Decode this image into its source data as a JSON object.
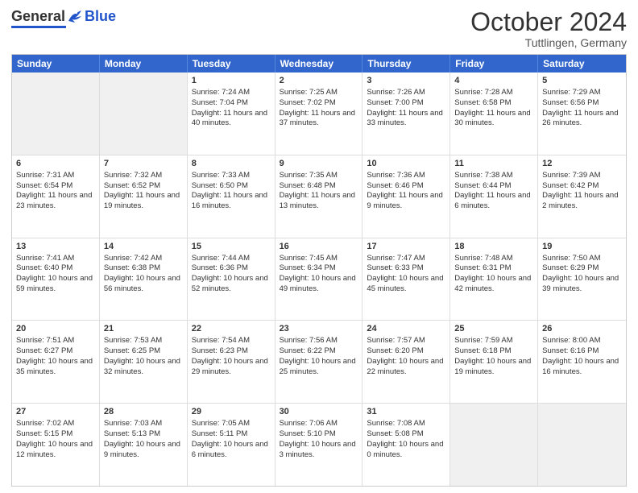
{
  "logo": {
    "general": "General",
    "blue": "Blue"
  },
  "header": {
    "month": "October 2024",
    "location": "Tuttlingen, Germany"
  },
  "days": [
    "Sunday",
    "Monday",
    "Tuesday",
    "Wednesday",
    "Thursday",
    "Friday",
    "Saturday"
  ],
  "rows": [
    [
      {
        "day": "",
        "sunrise": "",
        "sunset": "",
        "daylight": "",
        "shaded": true
      },
      {
        "day": "",
        "sunrise": "",
        "sunset": "",
        "daylight": "",
        "shaded": true
      },
      {
        "day": "1",
        "sunrise": "Sunrise: 7:24 AM",
        "sunset": "Sunset: 7:04 PM",
        "daylight": "Daylight: 11 hours and 40 minutes."
      },
      {
        "day": "2",
        "sunrise": "Sunrise: 7:25 AM",
        "sunset": "Sunset: 7:02 PM",
        "daylight": "Daylight: 11 hours and 37 minutes."
      },
      {
        "day": "3",
        "sunrise": "Sunrise: 7:26 AM",
        "sunset": "Sunset: 7:00 PM",
        "daylight": "Daylight: 11 hours and 33 minutes."
      },
      {
        "day": "4",
        "sunrise": "Sunrise: 7:28 AM",
        "sunset": "Sunset: 6:58 PM",
        "daylight": "Daylight: 11 hours and 30 minutes."
      },
      {
        "day": "5",
        "sunrise": "Sunrise: 7:29 AM",
        "sunset": "Sunset: 6:56 PM",
        "daylight": "Daylight: 11 hours and 26 minutes."
      }
    ],
    [
      {
        "day": "6",
        "sunrise": "Sunrise: 7:31 AM",
        "sunset": "Sunset: 6:54 PM",
        "daylight": "Daylight: 11 hours and 23 minutes."
      },
      {
        "day": "7",
        "sunrise": "Sunrise: 7:32 AM",
        "sunset": "Sunset: 6:52 PM",
        "daylight": "Daylight: 11 hours and 19 minutes."
      },
      {
        "day": "8",
        "sunrise": "Sunrise: 7:33 AM",
        "sunset": "Sunset: 6:50 PM",
        "daylight": "Daylight: 11 hours and 16 minutes."
      },
      {
        "day": "9",
        "sunrise": "Sunrise: 7:35 AM",
        "sunset": "Sunset: 6:48 PM",
        "daylight": "Daylight: 11 hours and 13 minutes."
      },
      {
        "day": "10",
        "sunrise": "Sunrise: 7:36 AM",
        "sunset": "Sunset: 6:46 PM",
        "daylight": "Daylight: 11 hours and 9 minutes."
      },
      {
        "day": "11",
        "sunrise": "Sunrise: 7:38 AM",
        "sunset": "Sunset: 6:44 PM",
        "daylight": "Daylight: 11 hours and 6 minutes."
      },
      {
        "day": "12",
        "sunrise": "Sunrise: 7:39 AM",
        "sunset": "Sunset: 6:42 PM",
        "daylight": "Daylight: 11 hours and 2 minutes."
      }
    ],
    [
      {
        "day": "13",
        "sunrise": "Sunrise: 7:41 AM",
        "sunset": "Sunset: 6:40 PM",
        "daylight": "Daylight: 10 hours and 59 minutes."
      },
      {
        "day": "14",
        "sunrise": "Sunrise: 7:42 AM",
        "sunset": "Sunset: 6:38 PM",
        "daylight": "Daylight: 10 hours and 56 minutes."
      },
      {
        "day": "15",
        "sunrise": "Sunrise: 7:44 AM",
        "sunset": "Sunset: 6:36 PM",
        "daylight": "Daylight: 10 hours and 52 minutes."
      },
      {
        "day": "16",
        "sunrise": "Sunrise: 7:45 AM",
        "sunset": "Sunset: 6:34 PM",
        "daylight": "Daylight: 10 hours and 49 minutes."
      },
      {
        "day": "17",
        "sunrise": "Sunrise: 7:47 AM",
        "sunset": "Sunset: 6:33 PM",
        "daylight": "Daylight: 10 hours and 45 minutes."
      },
      {
        "day": "18",
        "sunrise": "Sunrise: 7:48 AM",
        "sunset": "Sunset: 6:31 PM",
        "daylight": "Daylight: 10 hours and 42 minutes."
      },
      {
        "day": "19",
        "sunrise": "Sunrise: 7:50 AM",
        "sunset": "Sunset: 6:29 PM",
        "daylight": "Daylight: 10 hours and 39 minutes."
      }
    ],
    [
      {
        "day": "20",
        "sunrise": "Sunrise: 7:51 AM",
        "sunset": "Sunset: 6:27 PM",
        "daylight": "Daylight: 10 hours and 35 minutes."
      },
      {
        "day": "21",
        "sunrise": "Sunrise: 7:53 AM",
        "sunset": "Sunset: 6:25 PM",
        "daylight": "Daylight: 10 hours and 32 minutes."
      },
      {
        "day": "22",
        "sunrise": "Sunrise: 7:54 AM",
        "sunset": "Sunset: 6:23 PM",
        "daylight": "Daylight: 10 hours and 29 minutes."
      },
      {
        "day": "23",
        "sunrise": "Sunrise: 7:56 AM",
        "sunset": "Sunset: 6:22 PM",
        "daylight": "Daylight: 10 hours and 25 minutes."
      },
      {
        "day": "24",
        "sunrise": "Sunrise: 7:57 AM",
        "sunset": "Sunset: 6:20 PM",
        "daylight": "Daylight: 10 hours and 22 minutes."
      },
      {
        "day": "25",
        "sunrise": "Sunrise: 7:59 AM",
        "sunset": "Sunset: 6:18 PM",
        "daylight": "Daylight: 10 hours and 19 minutes."
      },
      {
        "day": "26",
        "sunrise": "Sunrise: 8:00 AM",
        "sunset": "Sunset: 6:16 PM",
        "daylight": "Daylight: 10 hours and 16 minutes."
      }
    ],
    [
      {
        "day": "27",
        "sunrise": "Sunrise: 7:02 AM",
        "sunset": "Sunset: 5:15 PM",
        "daylight": "Daylight: 10 hours and 12 minutes."
      },
      {
        "day": "28",
        "sunrise": "Sunrise: 7:03 AM",
        "sunset": "Sunset: 5:13 PM",
        "daylight": "Daylight: 10 hours and 9 minutes."
      },
      {
        "day": "29",
        "sunrise": "Sunrise: 7:05 AM",
        "sunset": "Sunset: 5:11 PM",
        "daylight": "Daylight: 10 hours and 6 minutes."
      },
      {
        "day": "30",
        "sunrise": "Sunrise: 7:06 AM",
        "sunset": "Sunset: 5:10 PM",
        "daylight": "Daylight: 10 hours and 3 minutes."
      },
      {
        "day": "31",
        "sunrise": "Sunrise: 7:08 AM",
        "sunset": "Sunset: 5:08 PM",
        "daylight": "Daylight: 10 hours and 0 minutes."
      },
      {
        "day": "",
        "sunrise": "",
        "sunset": "",
        "daylight": "",
        "shaded": true
      },
      {
        "day": "",
        "sunrise": "",
        "sunset": "",
        "daylight": "",
        "shaded": true
      }
    ]
  ]
}
